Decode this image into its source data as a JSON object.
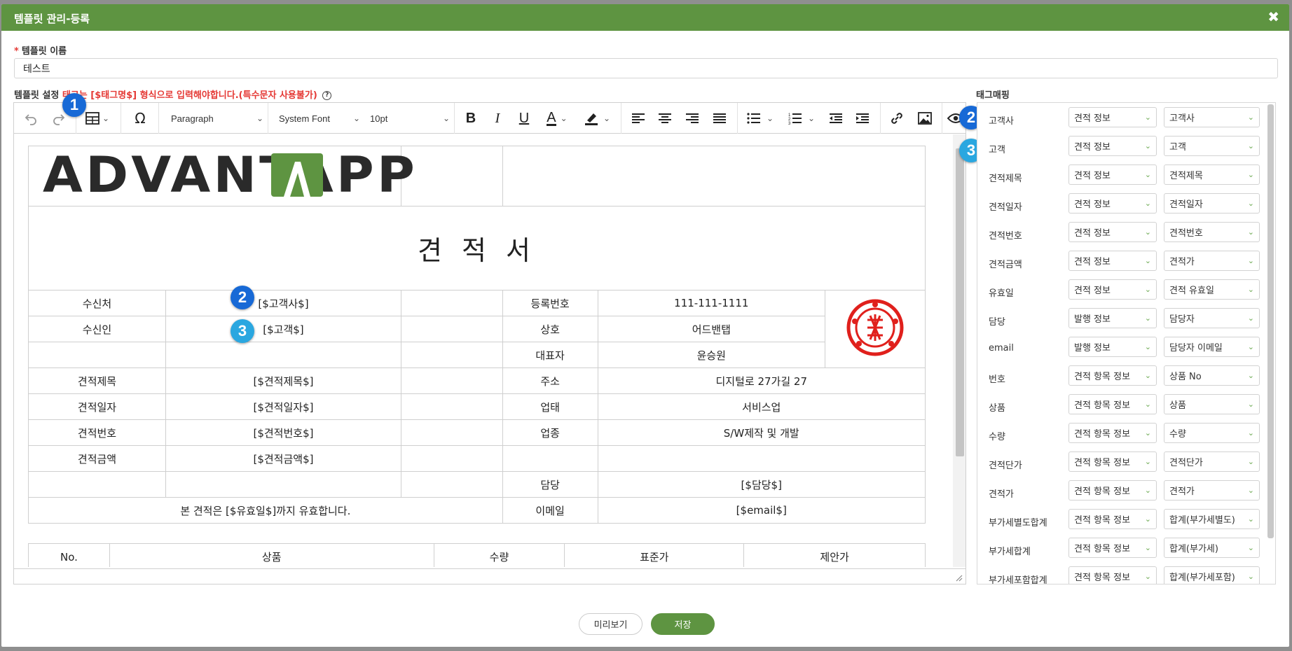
{
  "window": {
    "title": "템플릿 관리-등록",
    "close_glyph": "✖"
  },
  "template_name": {
    "required_mark": "*",
    "label": "템플릿 이름",
    "value": "테스트"
  },
  "template_setting": {
    "label": "템플릿 설정",
    "warning_prefix": "태그는 ",
    "warning": "[$태그명$] 형식으로 입력해야합니다.(특수문자 사용불가)",
    "help_glyph": "?"
  },
  "toolbar": {
    "paragraph": "Paragraph",
    "font": "System Font",
    "size": "10pt",
    "bold": "B",
    "italic": "I",
    "underline": "U",
    "text_color": "A",
    "omega": "Ω"
  },
  "quote": {
    "logo": "ADVANTAPP",
    "title": "견 적 서",
    "rows": [
      [
        "수신처",
        "[$고객사$]",
        "등록번호",
        "111-111-1111"
      ],
      [
        "수신인",
        "[$고객$]",
        "상호",
        "어드밴탭"
      ],
      [
        "",
        "",
        "대표자",
        "윤승원"
      ],
      [
        "견적제목",
        "[$견적제목$]",
        "주소",
        "디지털로 27가길 27"
      ],
      [
        "견적일자",
        "[$견적일자$]",
        "업태",
        "서비스업"
      ],
      [
        "견적번호",
        "[$견적번호$]",
        "업종",
        "S/W제작 및 개발"
      ],
      [
        "견적금액",
        "[$견적금액$]",
        "",
        ""
      ],
      [
        "",
        "",
        "담당",
        "[$담당$]"
      ]
    ],
    "validity": "본 견적은 [$유효일$]까지 유효합니다.",
    "email_label": "이메일",
    "email_value": "[$email$]",
    "items_header": [
      "No.",
      "상품",
      "수량",
      "표준가",
      "제안가"
    ]
  },
  "badges": {
    "one": "1",
    "two": "2",
    "three": "3"
  },
  "tag_mapping": {
    "title": "태그매핑",
    "rows": [
      {
        "tag": "고객사",
        "group": "견적 정보",
        "field": "고객사"
      },
      {
        "tag": "고객",
        "group": "견적 정보",
        "field": "고객"
      },
      {
        "tag": "견적제목",
        "group": "견적 정보",
        "field": "견적제목"
      },
      {
        "tag": "견적일자",
        "group": "견적 정보",
        "field": "견적일자"
      },
      {
        "tag": "견적번호",
        "group": "견적 정보",
        "field": "견적번호"
      },
      {
        "tag": "견적금액",
        "group": "견적 정보",
        "field": "견적가"
      },
      {
        "tag": "유효일",
        "group": "견적 정보",
        "field": "견적 유효일"
      },
      {
        "tag": "담당",
        "group": "발행 정보",
        "field": "담당자"
      },
      {
        "tag": "email",
        "group": "발행 정보",
        "field": "담당자 이메일"
      },
      {
        "tag": "번호",
        "group": "견적 항목 정보",
        "field": "상품 No"
      },
      {
        "tag": "상품",
        "group": "견적 항목 정보",
        "field": "상품"
      },
      {
        "tag": "수량",
        "group": "견적 항목 정보",
        "field": "수량"
      },
      {
        "tag": "견적단가",
        "group": "견적 항목 정보",
        "field": "견적단가"
      },
      {
        "tag": "견적가",
        "group": "견적 항목 정보",
        "field": "견적가"
      },
      {
        "tag": "부가세별도합계",
        "group": "견적 항목 정보",
        "field": "합계(부가세별도)"
      },
      {
        "tag": "부가세합계",
        "group": "견적 항목 정보",
        "field": "합계(부가세)"
      },
      {
        "tag": "부가세포함합계",
        "group": "견적 항목 정보",
        "field": "합계(부가세포함)"
      }
    ]
  },
  "buttons": {
    "preview": "미리보기",
    "save": "저장"
  },
  "colors": {
    "header_green": "#5e9441",
    "warning_red": "#e53935",
    "badge_dark": "#1769d6",
    "badge_light": "#2aa7e0",
    "stamp_red": "#e0201c"
  }
}
